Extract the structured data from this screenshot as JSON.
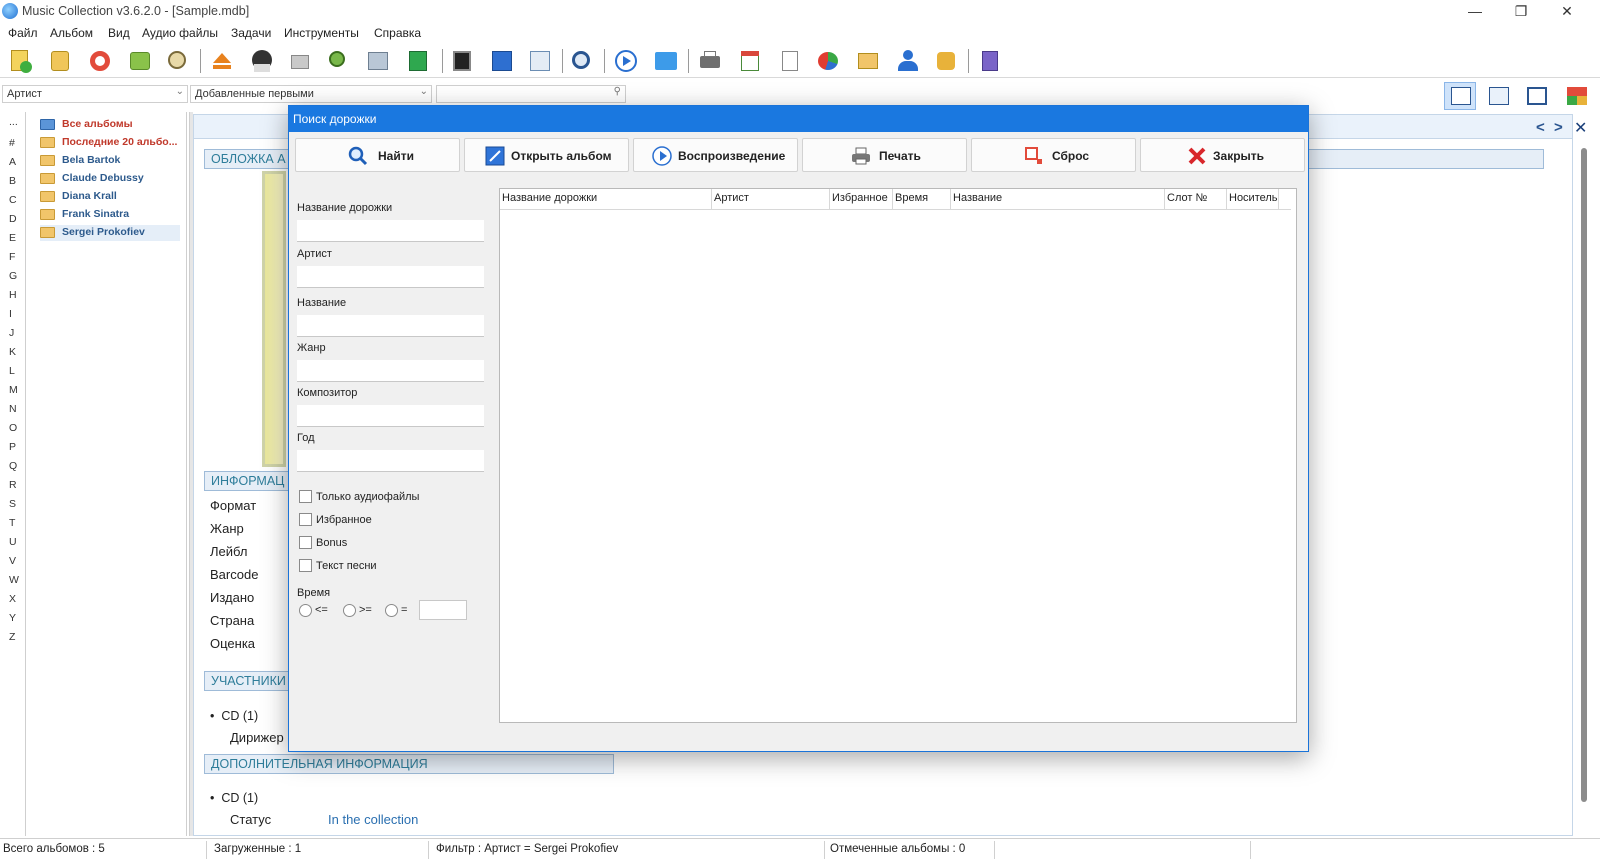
{
  "window": {
    "title": "Music Collection v3.6.2.0 - [Sample.mdb]"
  },
  "menu": [
    "Файл",
    "Альбом",
    "Вид",
    "Аудио файлы",
    "Задачи",
    "Инструменты",
    "Справка"
  ],
  "filter": {
    "group_by": "Артист",
    "sort_by": "Добавленные первыми",
    "search_value": ""
  },
  "alphabet": [
    "...",
    "#",
    "A",
    "B",
    "C",
    "D",
    "E",
    "F",
    "G",
    "H",
    "I",
    "J",
    "K",
    "L",
    "M",
    "N",
    "O",
    "P",
    "Q",
    "R",
    "S",
    "T",
    "U",
    "V",
    "W",
    "X",
    "Y",
    "Z"
  ],
  "tree": [
    {
      "label": "Все альбомы",
      "style": "red",
      "icon": "blue-folder-icon"
    },
    {
      "label": "Последние 20 альбо...",
      "style": "red",
      "icon": "folder-icon"
    },
    {
      "label": "Bela Bartok",
      "style": "normal",
      "icon": "folder-icon"
    },
    {
      "label": "Claude Debussy",
      "style": "normal",
      "icon": "folder-icon"
    },
    {
      "label": "Diana Krall",
      "style": "normal",
      "icon": "folder-icon"
    },
    {
      "label": "Frank Sinatra",
      "style": "normal",
      "icon": "folder-icon"
    },
    {
      "label": "Sergei Prokofiev",
      "style": "selected",
      "icon": "folder-icon"
    }
  ],
  "album_panel": {
    "cover_title": "ОБЛОЖКА А",
    "info_title": "ИНФОРМАЦ",
    "info_labels": [
      "Формат",
      "Жанр",
      "Лейбл",
      "Barcode",
      "Издано",
      "Страна",
      "Оценка"
    ],
    "participants_title": "УЧАСТНИКИ",
    "participants_disc": "CD (1)",
    "participants_role": "Дирижер",
    "additional_title": "ДОПОЛНИТЕЛЬНАЯ ИНФОРМАЦИЯ",
    "additional_disc": "CD (1)",
    "status_label": "Статус",
    "status_value": "In the collection"
  },
  "dialog": {
    "title": "Поиск дорожки",
    "buttons": {
      "find": "Найти",
      "open_album": "Открыть альбом",
      "play": "Воспроизведение",
      "print": "Печать",
      "reset": "Сброс",
      "close": "Закрыть"
    },
    "fields": {
      "track_name": {
        "label": "Название дорожки",
        "value": ""
      },
      "artist": {
        "label": "Артист",
        "value": ""
      },
      "title": {
        "label": "Название",
        "value": ""
      },
      "genre": {
        "label": "Жанр",
        "value": ""
      },
      "composer": {
        "label": "Композитор",
        "value": ""
      },
      "year": {
        "label": "Год",
        "value": ""
      }
    },
    "checkboxes": {
      "audio_only": "Только аудиофайлы",
      "favorite": "Избранное",
      "bonus": "Bonus",
      "lyrics": "Текст песни"
    },
    "time": {
      "label": "Время",
      "le": "<=",
      "ge": ">=",
      "eq": "=",
      "value": ""
    },
    "columns": [
      "Название дорожки",
      "Артист",
      "Избранное",
      "Время",
      "Название",
      "Слот №",
      "Носитель"
    ]
  },
  "status": {
    "total": "Всего альбомов : 5",
    "loaded": "Загруженные : 1",
    "filter": "Фильтр : Артист = Sergei Prokofiev",
    "marked": "Отмеченные альбомы : 0"
  }
}
